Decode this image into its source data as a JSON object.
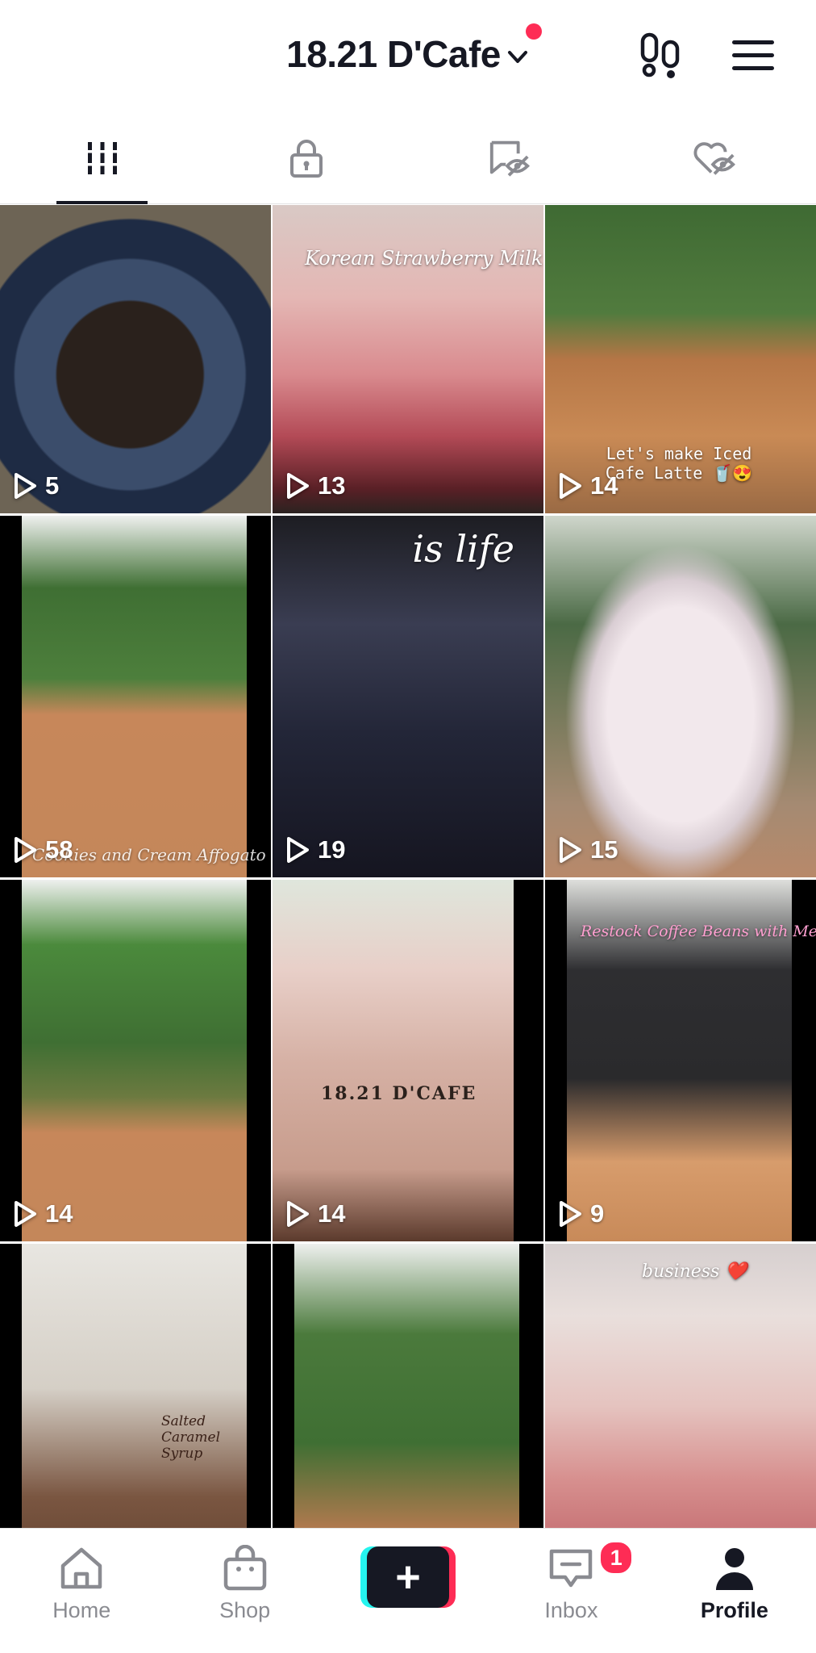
{
  "header": {
    "account_name": "18.21 D'Cafe"
  },
  "tabs": [
    {
      "name": "videos",
      "icon": "grid-icon"
    },
    {
      "name": "private",
      "icon": "lock-icon"
    },
    {
      "name": "reposts",
      "icon": "repost-hidden-icon"
    },
    {
      "name": "liked",
      "icon": "heart-hidden-icon"
    }
  ],
  "videos": [
    {
      "views": "5"
    },
    {
      "views": "13",
      "caption": "Korean Strawberry Milk 🍓"
    },
    {
      "views": "14",
      "caption": "Let's make Iced Cafe Latte 🥤😍"
    },
    {
      "views": "58",
      "caption": "Cookies and Cream Affogato"
    },
    {
      "views": "19",
      "caption": "is life"
    },
    {
      "views": "15"
    },
    {
      "views": "14"
    },
    {
      "views": "14",
      "caption": "18.21 D'CAFE"
    },
    {
      "views": "9",
      "caption": "Restock Coffee Beans with Me ☕"
    },
    {
      "caption": "Salted Caramel Syrup"
    },
    {},
    {
      "caption": "business ❤️"
    }
  ],
  "bottom_nav": {
    "home": "Home",
    "shop": "Shop",
    "create": "+",
    "inbox": "Inbox",
    "inbox_badge": "1",
    "profile": "Profile"
  },
  "colors": {
    "accent_red": "#fe2c55",
    "accent_cyan": "#25f4ee",
    "text_primary": "#161823",
    "text_secondary": "#8a8b91"
  }
}
